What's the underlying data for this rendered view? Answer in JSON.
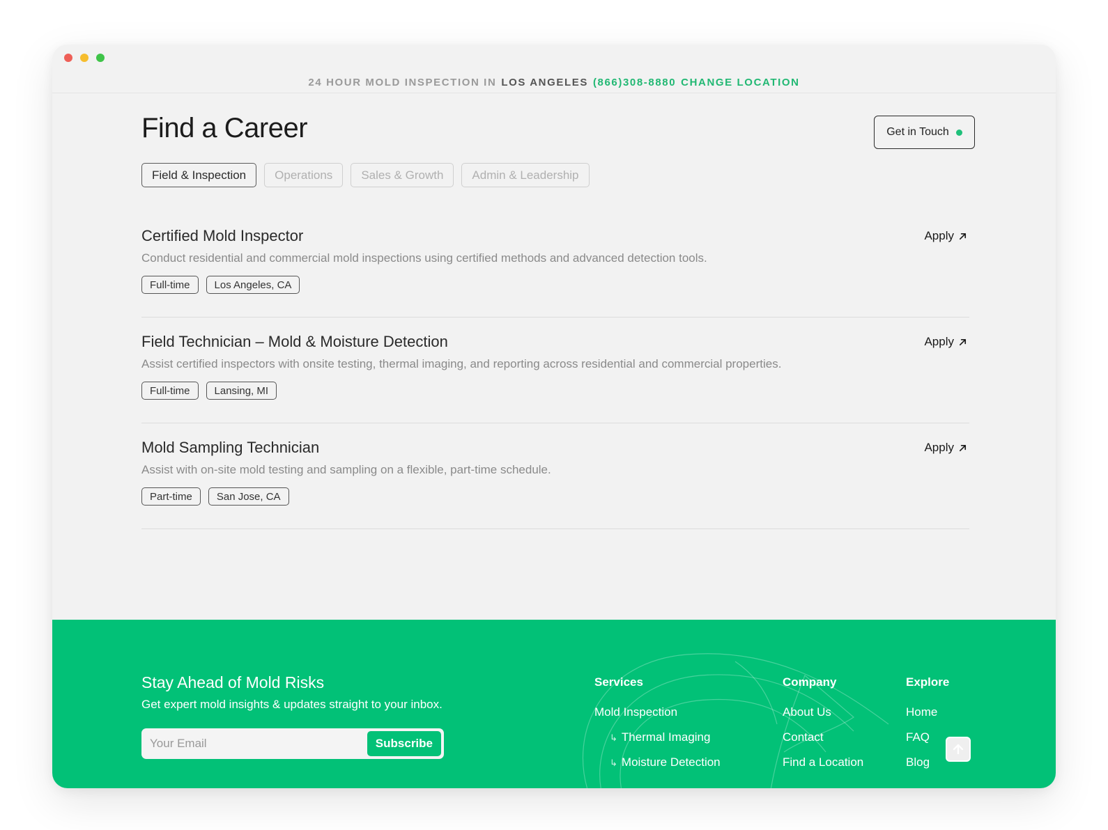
{
  "topbar": {
    "prefix": "24 HOUR MOLD INSPECTION IN",
    "location": "LOS ANGELES",
    "phone": "(866)308-8880",
    "change": "CHANGE LOCATION"
  },
  "header": {
    "title": "Find a Career",
    "cta_label": "Get in Touch"
  },
  "tabs": [
    {
      "label": "Field & Inspection",
      "active": true
    },
    {
      "label": "Operations",
      "active": false
    },
    {
      "label": "Sales & Growth",
      "active": false
    },
    {
      "label": "Admin & Leadership",
      "active": false
    }
  ],
  "jobs": [
    {
      "title": "Certified Mold Inspector",
      "description": "Conduct residential and commercial mold inspections using certified methods and advanced detection tools.",
      "type": "Full-time",
      "location": "Los Angeles, CA",
      "apply_label": "Apply"
    },
    {
      "title": "Field Technician – Mold & Moisture Detection",
      "description": "Assist certified inspectors with onsite testing, thermal imaging, and reporting across residential and commercial properties.",
      "type": "Full-time",
      "location": "Lansing, MI",
      "apply_label": "Apply"
    },
    {
      "title": "Mold Sampling Technician",
      "description": "Assist with on-site mold testing and sampling on a flexible, part-time schedule.",
      "type": "Part-time",
      "location": "San Jose, CA",
      "apply_label": "Apply"
    }
  ],
  "footer": {
    "newsletter_title": "Stay Ahead of Mold Risks",
    "newsletter_sub": "Get expert mold insights & updates straight to your inbox.",
    "email_placeholder": "Your Email",
    "subscribe_label": "Subscribe",
    "services": {
      "heading": "Services",
      "links": [
        "Mold Inspection",
        "Thermal Imaging",
        "Moisture Detection"
      ]
    },
    "company": {
      "heading": "Company",
      "links": [
        "About Us",
        "Contact",
        "Find a Location"
      ]
    },
    "explore": {
      "heading": "Explore",
      "links": [
        "Home",
        "FAQ",
        "Blog"
      ]
    }
  },
  "colors": {
    "brand_green": "#02c177",
    "accent_text_green": "#21b873",
    "page_bg": "#f2f2f2"
  },
  "icons": {
    "apply": "arrow-up-right-icon",
    "back_to_top": "arrow-up-icon",
    "sub_link": "return-arrow-icon"
  }
}
